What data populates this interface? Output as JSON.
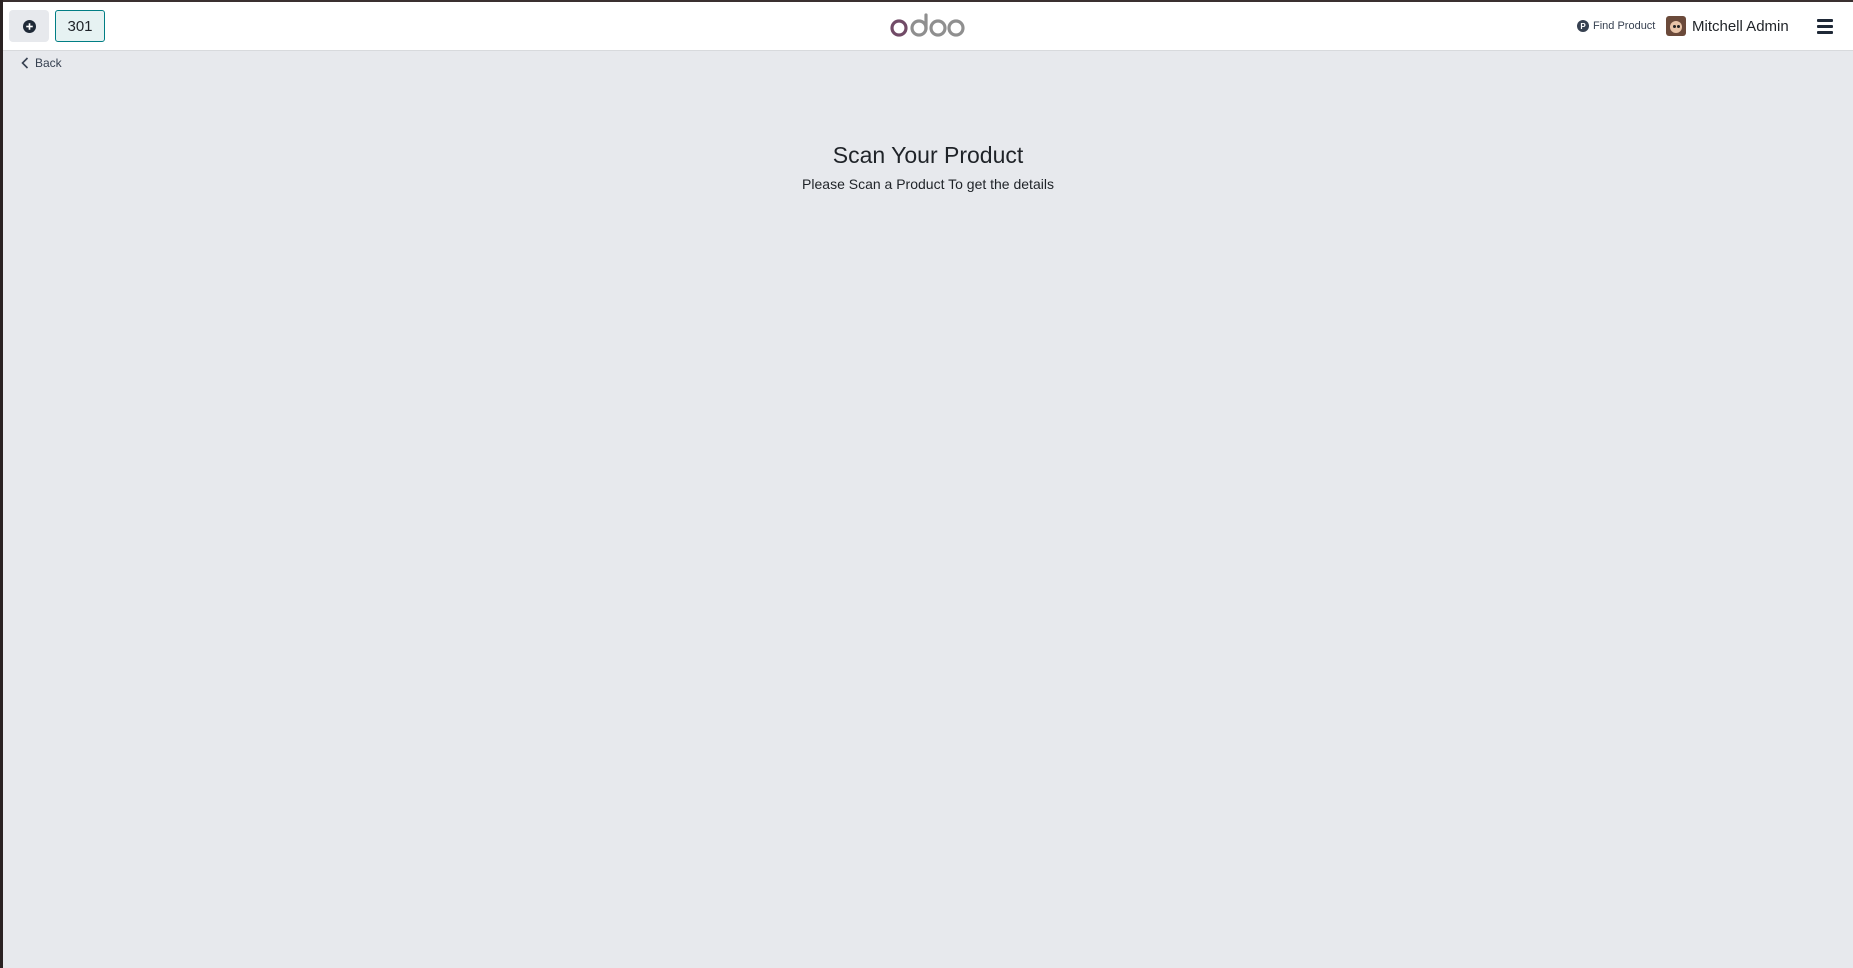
{
  "navbar": {
    "add_icon": "plus-circle-icon",
    "order_number": "301",
    "logo_text": "odoo",
    "find_product_icon": "product-p-icon",
    "find_product_label": "Find Product",
    "user_name": "Mitchell Admin",
    "menu_icon": "hamburger-icon"
  },
  "nav": {
    "back_label": "Back"
  },
  "main": {
    "title": "Scan Your Product",
    "subtitle": "Please Scan a Product To get the details"
  },
  "colors": {
    "background": "#e7e9ed",
    "navbar": "#ffffff",
    "accent_teal": "#017e84",
    "logo_purple": "#714b67",
    "logo_grey": "#8f8f8f",
    "text": "#1f2328"
  }
}
